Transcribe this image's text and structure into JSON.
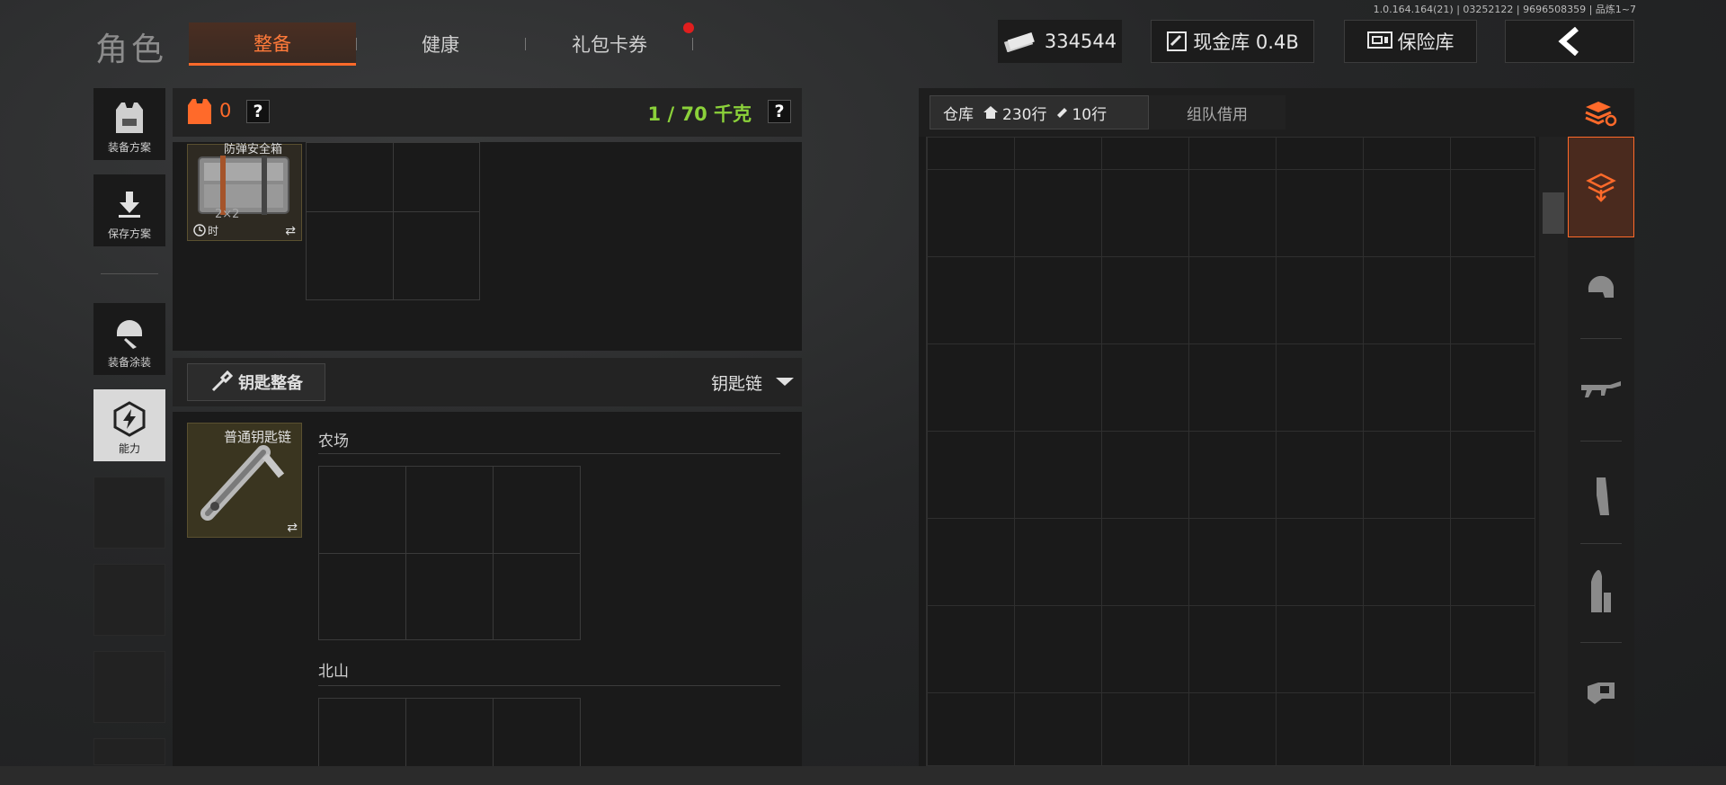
{
  "version": "1.0.164.164(21) | 03252122 | 9696508359 | 品炼1~7",
  "title": "角色",
  "tabs": [
    {
      "label": "整备",
      "active": true
    },
    {
      "label": "健康",
      "active": false
    },
    {
      "label": "礼包卡券",
      "active": false,
      "badge": true
    }
  ],
  "header": {
    "money": "334544",
    "cash_vault": "现金库 0.4B",
    "safe": "保险库"
  },
  "left_nav": [
    {
      "label": "装备方案",
      "icon": "vest-icon"
    },
    {
      "label": "保存方案",
      "icon": "download-icon"
    },
    {
      "label": "装备涂装",
      "icon": "helmet-paint-icon"
    },
    {
      "label": "能力",
      "icon": "ability-icon"
    }
  ],
  "loadout": {
    "armor_count": "0",
    "weight": "1 / 70 千克",
    "weight_color": "#8bd13a",
    "case_label": "防弹安全箱",
    "case_size": "2×2",
    "case_time": "时"
  },
  "keys": {
    "tab_label": "钥匙整备",
    "dropdown": "钥匙链",
    "keychain_label": "普通钥匙链",
    "sections": [
      "农场",
      "北山"
    ]
  },
  "warehouse": {
    "tab_label": "仓库",
    "rows": "230行",
    "tickets": "10行",
    "team_tab": "组队借用"
  },
  "colors": {
    "accent": "#ff6a2a",
    "weight_green": "#8bd13a"
  }
}
